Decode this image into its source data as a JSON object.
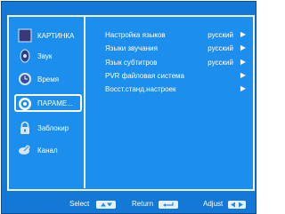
{
  "menu": {
    "items": [
      {
        "label": "КАРТИНКА",
        "icon": "picture-icon"
      },
      {
        "label": "Звук",
        "icon": "sound-icon"
      },
      {
        "label": "Время",
        "icon": "clock-icon"
      },
      {
        "label": "ПАРАМЕ...",
        "icon": "settings-gear-icon",
        "selected": true
      },
      {
        "label": "Заблокир",
        "icon": "lock-icon"
      },
      {
        "label": "Канал",
        "icon": "channel-satellite-icon"
      }
    ]
  },
  "settings": {
    "rows": [
      {
        "label": "Настройка языков",
        "value": "русский",
        "arrow": "▶"
      },
      {
        "label": "Языки звучания",
        "value": "русский",
        "arrow": "▶"
      },
      {
        "label": "Язык субтитров",
        "value": "русский",
        "arrow": "▶"
      },
      {
        "label": "PVR файловая система",
        "value": "",
        "arrow": "▶"
      },
      {
        "label": "Восст.станд.настроек",
        "value": "",
        "arrow": "▶"
      }
    ]
  },
  "bottom": {
    "select_label": "Select",
    "return_label": "Return",
    "adjust_label": "Adjust"
  },
  "colors": {
    "background": "#1c8fee",
    "frame": "#eef4ff",
    "text": "#ffffff"
  }
}
